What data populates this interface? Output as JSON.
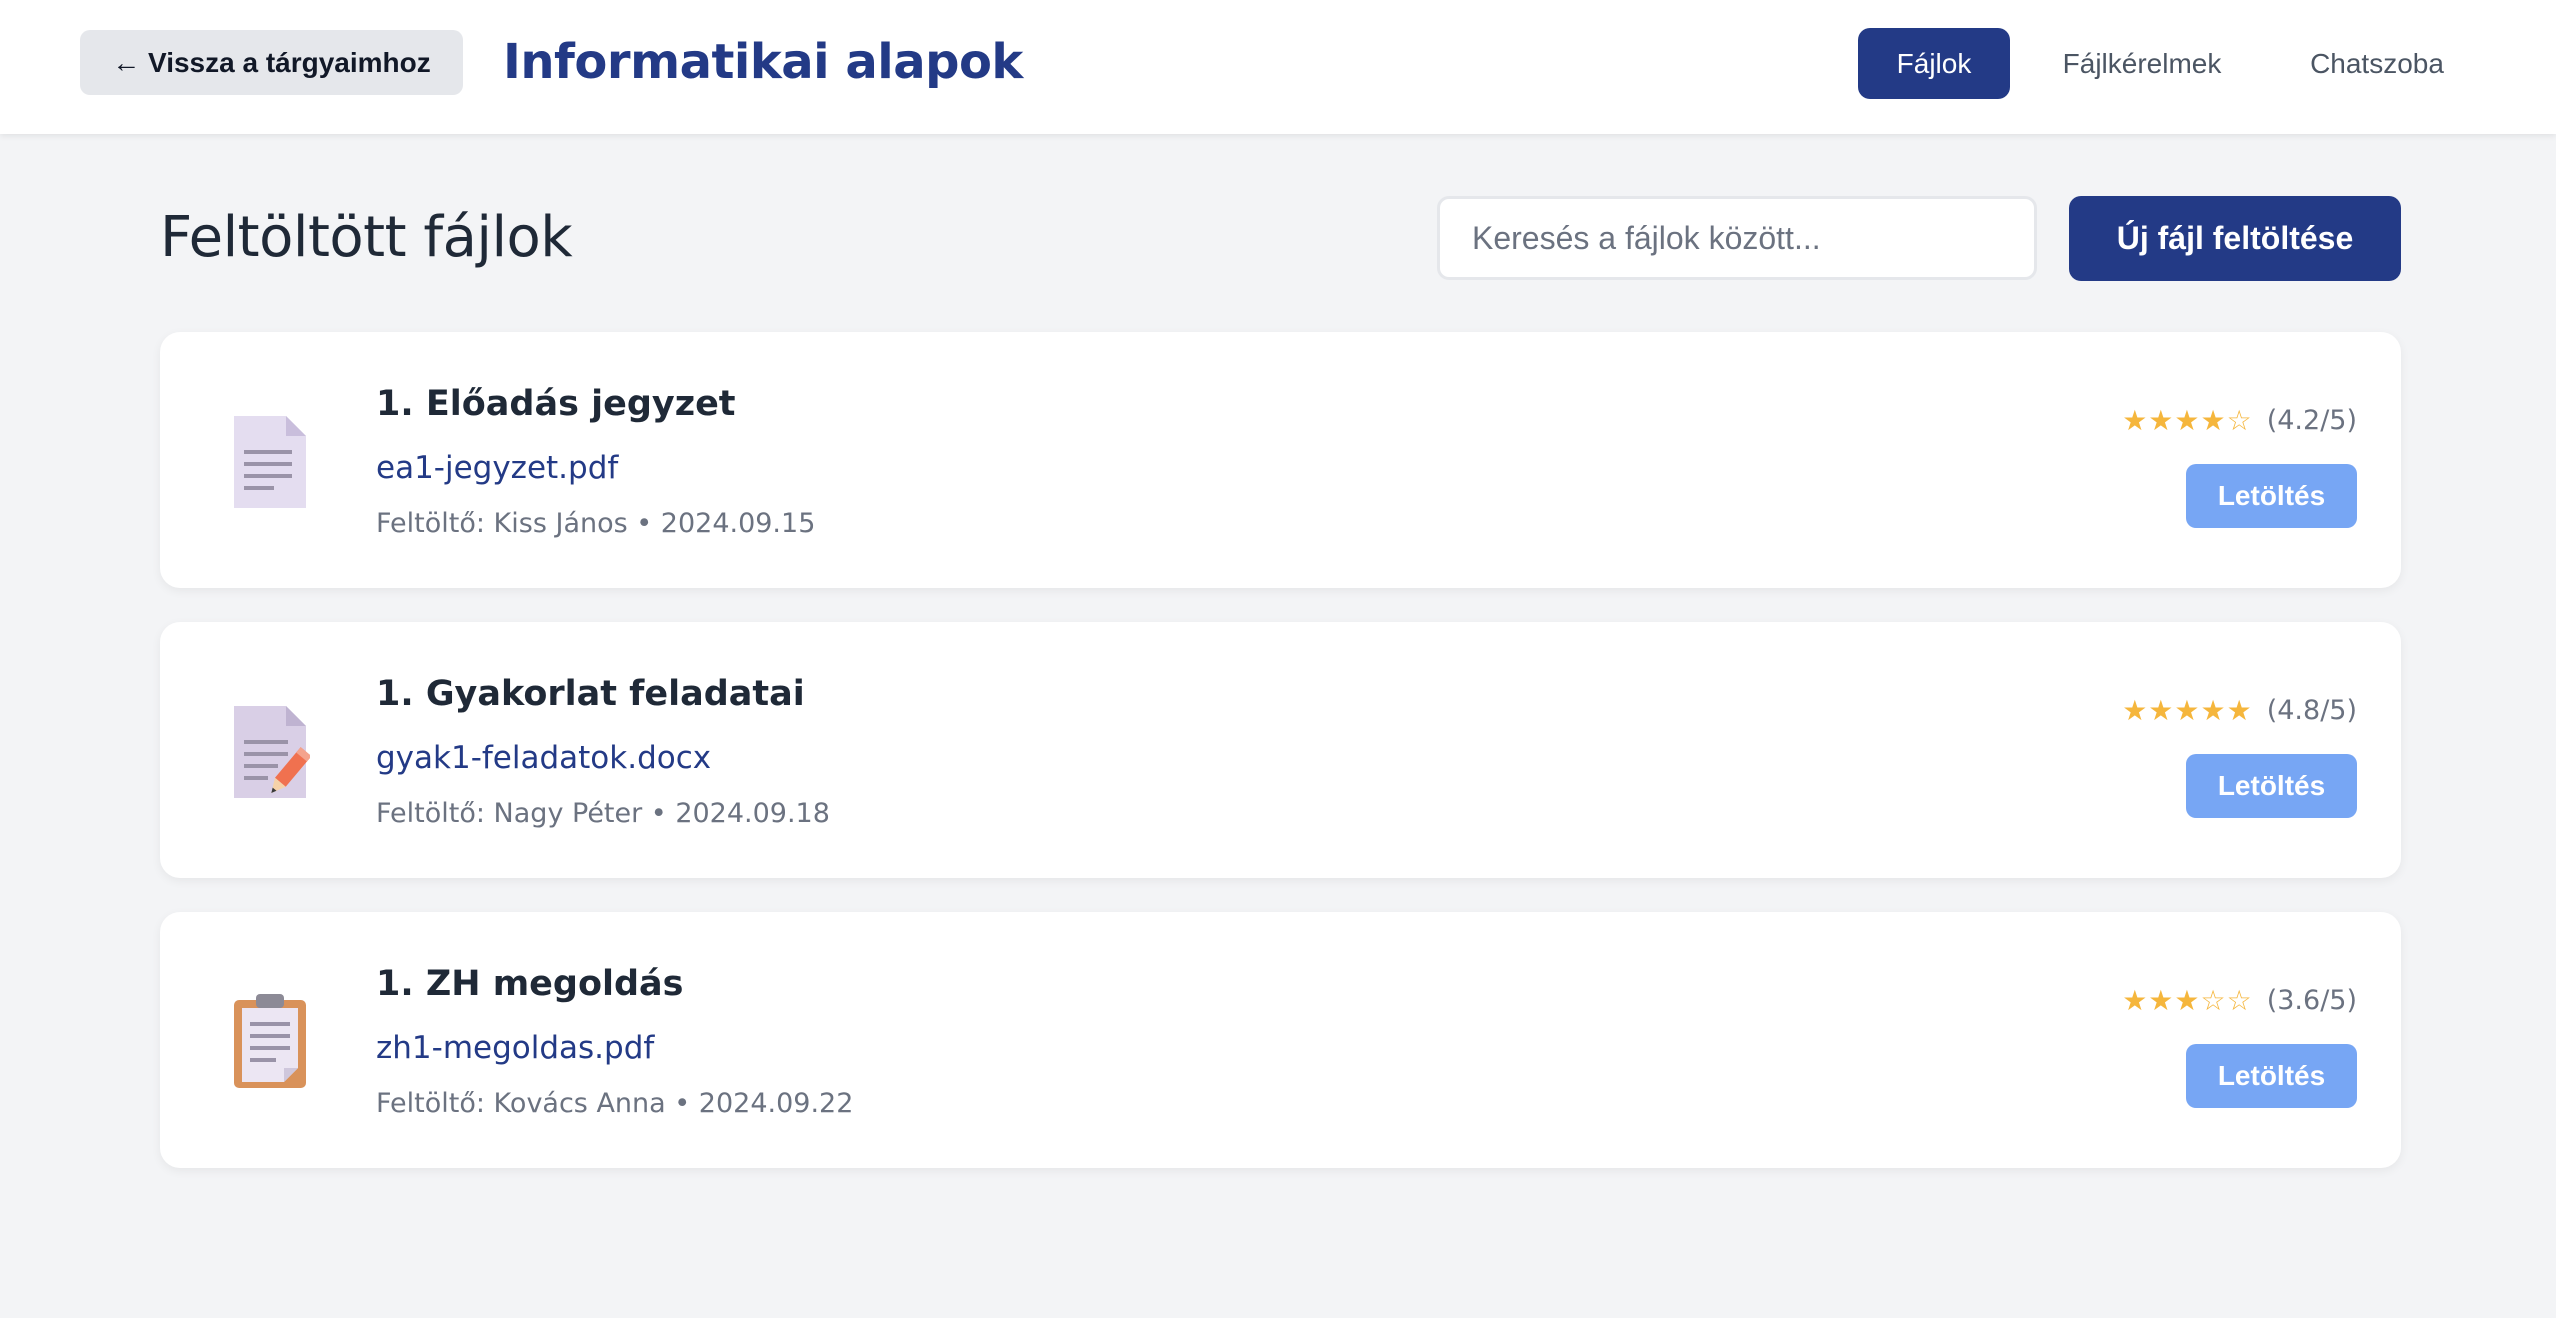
{
  "header": {
    "back_label": "← Vissza a tárgyaimhoz",
    "course_title": "Informatikai alapok",
    "tabs": [
      {
        "label": "Fájlok",
        "active": true
      },
      {
        "label": "Fájlkérelmek",
        "active": false
      },
      {
        "label": "Chatszoba",
        "active": false
      }
    ]
  },
  "main": {
    "heading": "Feltöltött fájlok",
    "search_placeholder": "Keresés a fájlok között...",
    "upload_label": "Új fájl feltöltése",
    "files": [
      {
        "icon": "document-icon",
        "title": "1. Előadás jegyzet",
        "filename": "ea1-jegyzet.pdf",
        "meta": "Feltöltő: Kiss János • 2024.09.15",
        "stars": "★★★★☆",
        "rating": "(4.2/5)",
        "download_label": "Letöltés"
      },
      {
        "icon": "document-edit-icon",
        "title": "1. Gyakorlat feladatai",
        "filename": "gyak1-feladatok.docx",
        "meta": "Feltöltő: Nagy Péter • 2024.09.18",
        "stars": "★★★★★",
        "rating": "(4.8/5)",
        "download_label": "Letöltés"
      },
      {
        "icon": "clipboard-icon",
        "title": "1. ZH megoldás",
        "filename": "zh1-megoldas.pdf",
        "meta": "Feltöltő: Kovács Anna • 2024.09.22",
        "stars": "★★★☆☆",
        "rating": "(3.6/5)",
        "download_label": "Letöltés"
      }
    ]
  },
  "colors": {
    "primary": "#233a86",
    "download_button": "#77a6f4",
    "star": "#f5b63c",
    "background": "#f3f4f6"
  }
}
